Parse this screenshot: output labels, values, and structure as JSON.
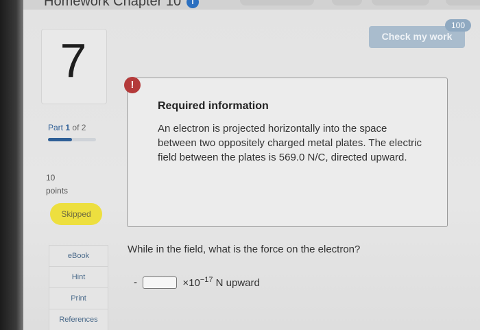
{
  "header": {
    "title": "Homework Chapter 10",
    "badge": "i"
  },
  "score": "100",
  "check_button": "Check my work",
  "question_number": "7",
  "part": {
    "prefix": "Part",
    "current": "1",
    "of_text": "of 2",
    "progress": 0.5
  },
  "points": {
    "value": "10",
    "label": "points"
  },
  "status_badge": "Skipped",
  "sidebar": {
    "items": [
      {
        "label": "eBook"
      },
      {
        "label": "Hint"
      },
      {
        "label": "Print"
      },
      {
        "label": "References"
      }
    ]
  },
  "alert_icon": "!",
  "required_info": {
    "title": "Required information",
    "text": "An electron is projected horizontally into the space between two oppositely charged metal plates. The electric field between the plates is 569.0 N/C, directed upward."
  },
  "question": "While in the field, what is the force on the electron?",
  "answer": {
    "sign": "-",
    "value": "",
    "multiplier": "×10",
    "exponent": "−17",
    "unit": "N upward"
  },
  "colors": {
    "accent": "#2e5f96",
    "alert": "#b43a3a",
    "skipped": "#eddf3f",
    "check_button": "#a9bccd"
  }
}
